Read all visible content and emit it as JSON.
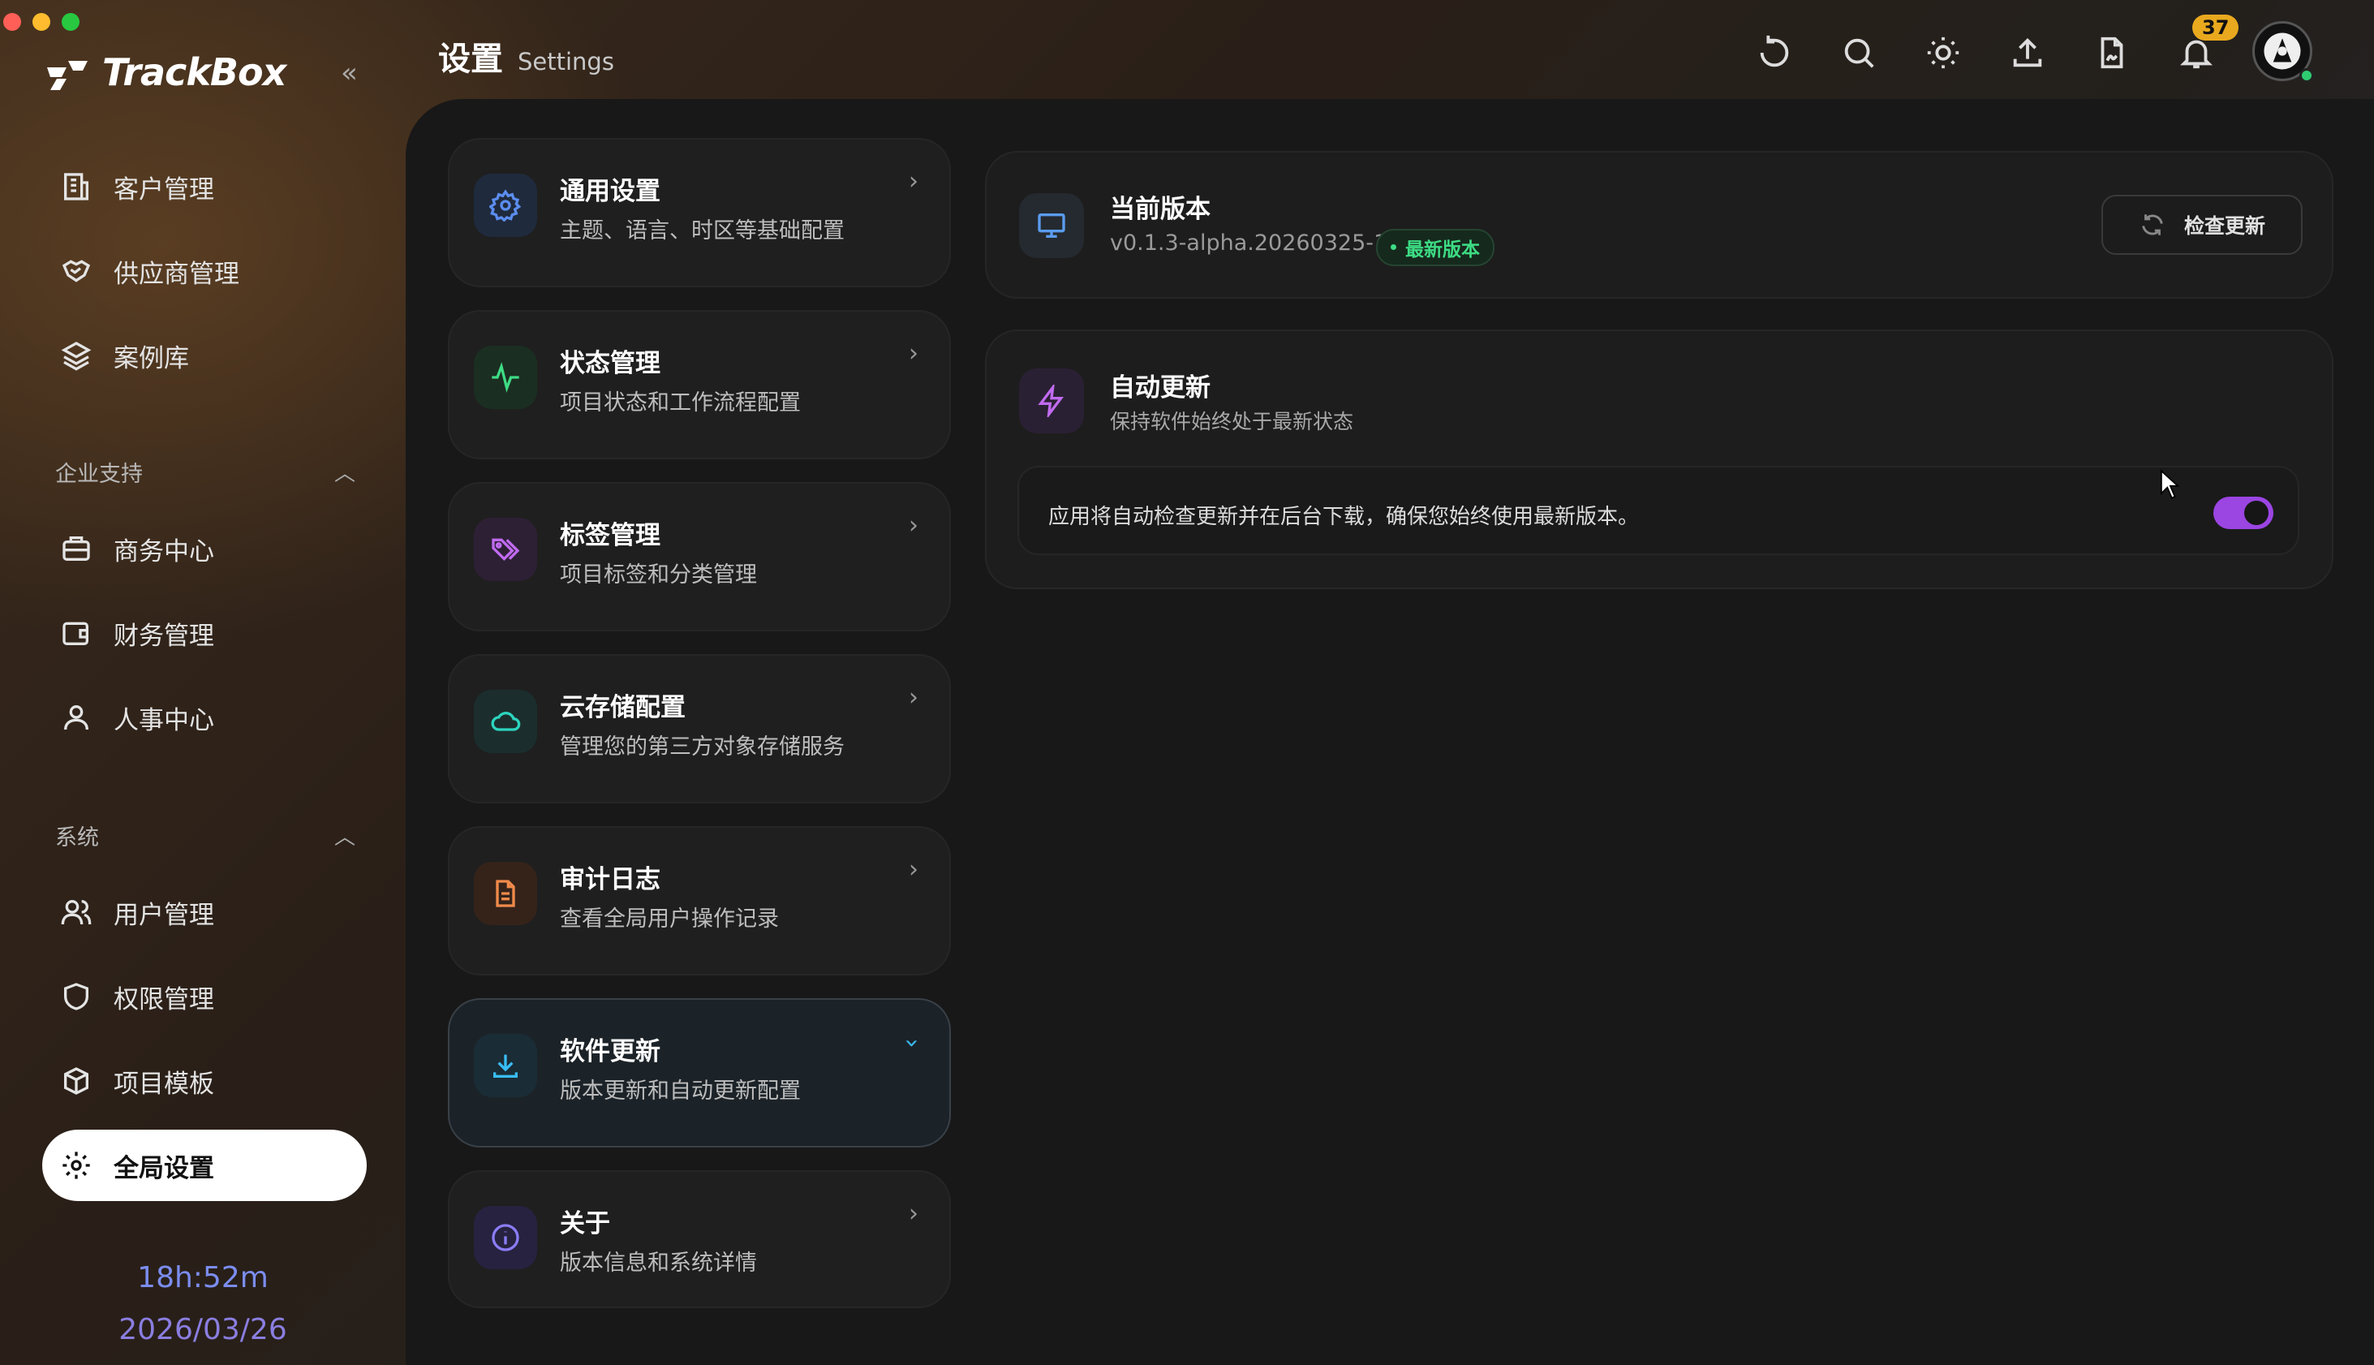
{
  "app": {
    "name": "TrackBox"
  },
  "sidebar": {
    "items_top": [
      {
        "label": "客户管理",
        "icon": "building-icon"
      },
      {
        "label": "供应商管理",
        "icon": "handshake-icon"
      },
      {
        "label": "案例库",
        "icon": "layers-icon"
      }
    ],
    "section_enterprise": "企业支持",
    "items_enterprise": [
      {
        "label": "商务中心",
        "icon": "briefcase-icon"
      },
      {
        "label": "财务管理",
        "icon": "wallet-icon"
      },
      {
        "label": "人事中心",
        "icon": "user-icon"
      }
    ],
    "section_system": "系统",
    "items_system": [
      {
        "label": "用户管理",
        "icon": "users-icon"
      },
      {
        "label": "权限管理",
        "icon": "shield-icon"
      },
      {
        "label": "项目模板",
        "icon": "box-icon"
      },
      {
        "label": "全局设置",
        "icon": "gear-icon",
        "active": true
      }
    ],
    "clock_time": "18h:52m",
    "clock_date": "2026/03/26"
  },
  "header": {
    "title": "设置",
    "subtitle": "Settings",
    "notification_count": "37"
  },
  "settings_menu": [
    {
      "title": "通用设置",
      "desc": "主题、语言、时区等基础配置",
      "icon": "gear-icon",
      "color": "#5b8def"
    },
    {
      "title": "状态管理",
      "desc": "项目状态和工作流程配置",
      "icon": "activity-icon",
      "color": "#3ddc84"
    },
    {
      "title": "标签管理",
      "desc": "项目标签和分类管理",
      "icon": "tags-icon",
      "color": "#c06bf0"
    },
    {
      "title": "云存储配置",
      "desc": "管理您的第三方对象存储服务",
      "icon": "cloud-icon",
      "color": "#2dd4bf"
    },
    {
      "title": "审计日志",
      "desc": "查看全局用户操作记录",
      "icon": "file-text-icon",
      "color": "#f08a4b"
    },
    {
      "title": "软件更新",
      "desc": "版本更新和自动更新配置",
      "icon": "download-icon",
      "color": "#38bdf8",
      "active": true
    },
    {
      "title": "关于",
      "desc": "版本信息和系统详情",
      "icon": "info-icon",
      "color": "#8b7cf6"
    }
  ],
  "version": {
    "title": "当前版本",
    "value": "v0.1.3-alpha.20260325-1",
    "badge": "最新版本",
    "check_button": "检查更新"
  },
  "auto_update": {
    "title": "自动更新",
    "subtitle": "保持软件始终处于最新状态",
    "description": "应用将自动检查更新并在后台下载，确保您始终使用最新版本。",
    "enabled": true
  },
  "colors": {
    "toggle_on": "#9b45e3",
    "latest_green": "#3ddc84",
    "badge_amber": "#e9a91e"
  }
}
